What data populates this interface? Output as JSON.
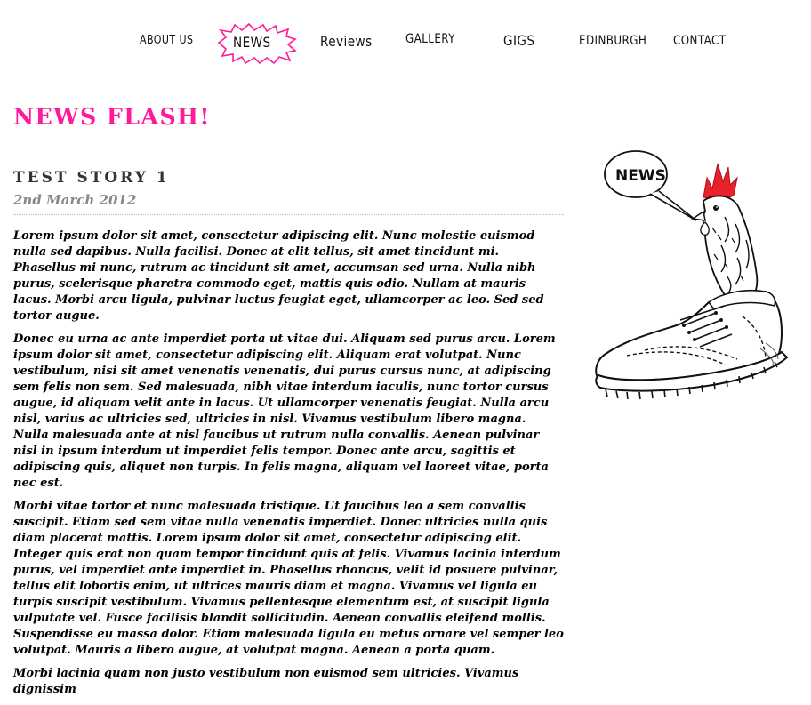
{
  "nav": {
    "items": [
      {
        "label": "About us"
      },
      {
        "label": "News"
      },
      {
        "label": "Reviews"
      },
      {
        "label": "Gallery"
      },
      {
        "label": "Gigs"
      },
      {
        "label": "Edinburgh"
      },
      {
        "label": "Contact"
      }
    ],
    "active": "News",
    "accent_color": "#ff1a9c"
  },
  "page": {
    "title": "NEWS FLASH!",
    "title_color": "#ff1a9c"
  },
  "story": {
    "title": "TEST STORY 1",
    "date": "2nd March 2012",
    "paragraphs": [
      "Lorem ipsum dolor sit amet, consectetur adipiscing elit. Nunc molestie euismod nulla sed dapibus. Nulla facilisi. Donec at elit tellus, sit amet tincidunt mi. Phasellus mi nunc, rutrum ac tincidunt sit amet, accumsan sed urna. Nulla nibh purus, scelerisque pharetra commodo eget, mattis quis odio. Nullam at mauris lacus. Morbi arcu ligula, pulvinar luctus feugiat eget, ullamcorper ac leo. Sed sed tortor augue.",
      "Donec eu urna ac ante imperdiet porta ut vitae dui. Aliquam sed purus arcu. Lorem ipsum dolor sit amet, consectetur adipiscing elit. Aliquam erat volutpat. Nunc vestibulum, nisi sit amet venenatis venenatis, dui purus cursus nunc, at adipiscing sem felis non sem. Sed malesuada, nibh vitae interdum iaculis, nunc tortor cursus augue, id aliquam velit ante in lacus. Ut ullamcorper venenatis feugiat. Nulla arcu nisl, varius ac ultricies sed, ultricies in nisl. Vivamus vestibulum libero magna. Nulla malesuada ante at nisl faucibus ut rutrum nulla convallis. Aenean pulvinar nisl in ipsum interdum ut imperdiet felis tempor. Donec ante arcu, sagittis et adipiscing quis, aliquet non turpis. In felis magna, aliquam vel laoreet vitae, porta nec est.",
      "Morbi vitae tortor et nunc malesuada tristique. Ut faucibus leo a sem convallis suscipit. Etiam sed sem vitae nulla venenatis imperdiet. Donec ultricies nulla quis diam placerat mattis. Lorem ipsum dolor sit amet, consectetur adipiscing elit. Integer quis erat non quam tempor tincidunt quis at felis. Vivamus lacinia interdum purus, vel imperdiet ante imperdiet in. Phasellus rhoncus, velit id posuere pulvinar, tellus elit lobortis enim, ut ultrices mauris diam et magna. Vivamus vel ligula eu turpis suscipit vestibulum. Vivamus pellentesque elementum est, at suscipit ligula vulputate vel. Fusce facilisis blandit sollicitudin. Aenean convallis eleifend mollis. Suspendisse eu massa dolor. Etiam malesuada ligula eu metus ornare vel semper leo volutpat. Mauris a libero augue, at volutpat magna. Aenean a porta quam.",
      "Morbi lacinia quam non justo vestibulum non euismod sem ultricies. Vivamus dignissim"
    ]
  },
  "illustration": {
    "speech_bubble_text": "NEWS",
    "comb_color": "#e8212b"
  }
}
